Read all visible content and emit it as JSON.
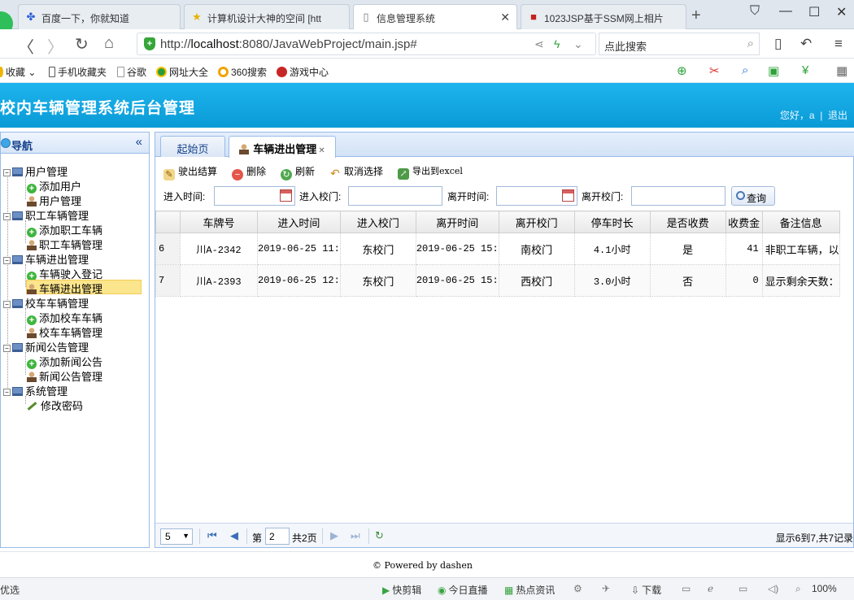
{
  "browser": {
    "tabs": [
      {
        "label": "百度一下，你就知道",
        "icon": "paw-icon"
      },
      {
        "label": "计算机设计大神的空间 [htt",
        "icon": "star-icon"
      },
      {
        "label": "信息管理系统",
        "icon": "page-icon"
      },
      {
        "label": "1023JSP基于SSM网上相片",
        "icon": "red-square-icon"
      }
    ],
    "url_prefix": "http://",
    "url_host": "localhost",
    "url_rest": ":8080/JavaWebProject/main.jsp#",
    "search_label": "点此搜索",
    "bookmarks": [
      "收藏",
      "手机收藏夹",
      "谷歌",
      "网址大全",
      "360搜索",
      "游戏中心"
    ]
  },
  "app": {
    "title": "校内车辆管理系统后台管理",
    "greeting": "您好，a",
    "logout": "退出"
  },
  "nav": {
    "title": "导航",
    "groups": [
      {
        "label": "用户管理",
        "items": [
          {
            "label": "添加用户",
            "icon": "add-icon"
          },
          {
            "label": "用户管理",
            "icon": "user-icon"
          }
        ]
      },
      {
        "label": "职工车辆管理",
        "items": [
          {
            "label": "添加职工车辆",
            "icon": "add-icon"
          },
          {
            "label": "职工车辆管理",
            "icon": "user-icon"
          }
        ]
      },
      {
        "label": "车辆进出管理",
        "items": [
          {
            "label": "车辆驶入登记",
            "icon": "add-icon"
          },
          {
            "label": "车辆进出管理",
            "icon": "user-icon"
          }
        ]
      },
      {
        "label": "校车车辆管理",
        "items": [
          {
            "label": "添加校车车辆",
            "icon": "add-icon"
          },
          {
            "label": "校车车辆管理",
            "icon": "user-icon"
          }
        ]
      },
      {
        "label": "新闻公告管理",
        "items": [
          {
            "label": "添加新闻公告",
            "icon": "add-icon"
          },
          {
            "label": "新闻公告管理",
            "icon": "user-icon"
          }
        ]
      },
      {
        "label": "系统管理",
        "items": [
          {
            "label": "修改密码",
            "icon": "pencil-icon"
          }
        ]
      }
    ]
  },
  "tabs": {
    "home": "起始页",
    "current": "车辆进出管理"
  },
  "toolbar": {
    "checkout": "驶出结算",
    "delete": "删除",
    "refresh": "刷新",
    "cancel": "取消选择",
    "export": "导出到excel"
  },
  "filters": {
    "in_time": "进入时间:",
    "in_gate": "进入校门:",
    "out_time": "离开时间:",
    "out_gate": "离开校门:",
    "query": "查询"
  },
  "table": {
    "columns": [
      "车牌号",
      "进入时间",
      "进入校门",
      "离开时间",
      "离开校门",
      "停车时长",
      "是否收费",
      "收费金",
      "备注信息"
    ],
    "rows": [
      {
        "no": "6",
        "plate": "川A-2342",
        "in_time": "2019-06-25 11:",
        "in_gate": "东校门",
        "out_time": "2019-06-25 15:",
        "out_gate": "南校门",
        "duration": "4.1小时",
        "charged": "是",
        "fee": "41",
        "note": "非职工车辆，以"
      },
      {
        "no": "7",
        "plate": "川A-2393",
        "in_time": "2019-06-25 12:",
        "in_gate": "东校门",
        "out_time": "2019-06-25 15:",
        "out_gate": "西校门",
        "duration": "3.0小时",
        "charged": "否",
        "fee": "0",
        "note": "显示剩余天数："
      }
    ]
  },
  "pager": {
    "page_size": "5",
    "page_label": "第",
    "page_value": "2",
    "total_pages": "共2页",
    "info": "显示6到7,共7记录"
  },
  "footer": "© Powered by dashen",
  "statusbar": {
    "left": "优选",
    "items": [
      "快剪辑",
      "今日直播",
      "热点资讯",
      "下载",
      "100%"
    ]
  }
}
